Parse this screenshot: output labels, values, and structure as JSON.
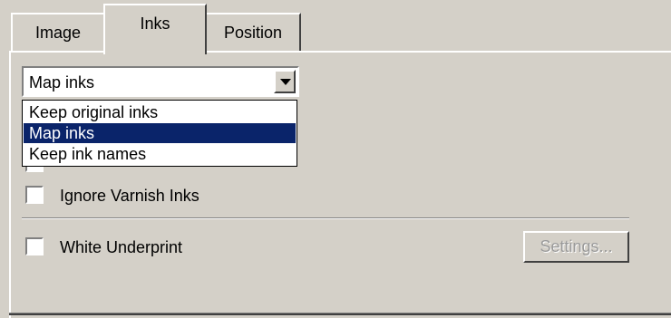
{
  "tabs": [
    {
      "label": "Image",
      "active": false
    },
    {
      "label": "Inks",
      "active": true
    },
    {
      "label": "Position",
      "active": false
    }
  ],
  "ink_mode": {
    "selected": "Map inks",
    "options": [
      "Keep original inks",
      "Map inks",
      "Keep ink names"
    ],
    "highlighted_index": 1,
    "expanded": true
  },
  "checkboxes": {
    "ignore_varnish": {
      "label": "Ignore Varnish Inks",
      "checked": false
    },
    "white_underprint": {
      "label": "White Underprint",
      "checked": false
    }
  },
  "settings_button": {
    "label": "Settings...",
    "enabled": false
  },
  "colors": {
    "face": "#d4d0c8",
    "highlight": "#0a246a",
    "disabled_text": "#9a9a9a"
  }
}
